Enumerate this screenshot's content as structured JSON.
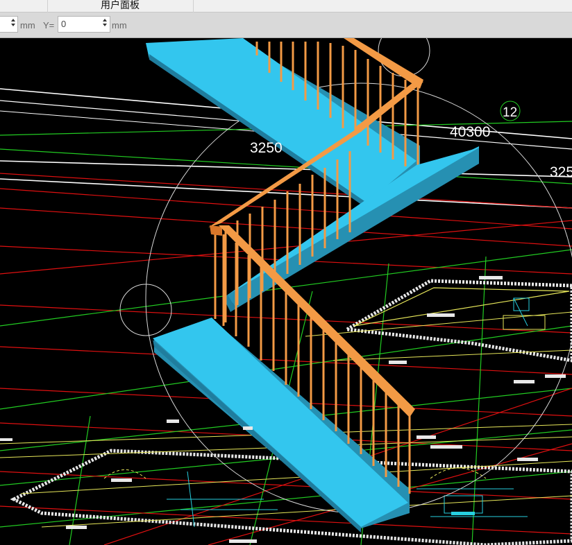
{
  "panel": {
    "title": "用户面板"
  },
  "coords": {
    "x_unit": "mm",
    "y_label": "Y=",
    "y_value": "0",
    "y_unit": "mm"
  },
  "drawing": {
    "dim_3250_left": "3250",
    "dim_40300": "40300",
    "dim_325_right": "325",
    "axis_bubble": "12",
    "colors": {
      "stair_top": "#33c6ee",
      "stair_side": "#2690b2",
      "stair_front": "#1f7d9e",
      "railing": "#f39a45",
      "railing_dark": "#d9772a",
      "grid_red": "#e01010",
      "grid_green": "#22cc22",
      "cad_yellow": "#e8e85a",
      "cad_cyan": "#27d0e0",
      "cad_white": "#e8e8e8"
    }
  }
}
